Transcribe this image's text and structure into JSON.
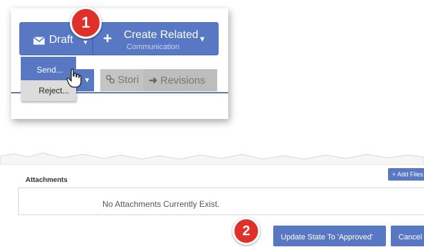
{
  "toolbar": {
    "draft_label": "Draft",
    "create_related_label": "Create Related",
    "create_related_sub": "Communication"
  },
  "dropdown": {
    "send_label": "Send...",
    "reject_label": "Reject..."
  },
  "tabs": {
    "stories_label": "Stori",
    "revisions_label": "Revisions"
  },
  "callouts": {
    "first": "1",
    "second": "2"
  },
  "attachments": {
    "title": "Attachments",
    "add_files_label": "Add Files",
    "empty_message": "No Attachments Currently Exist."
  },
  "actions": {
    "update_state_label": "Update State To 'Approved'",
    "cancel_label": "Cancel"
  },
  "colors": {
    "primary": "#5878c4",
    "callout": "#e0302a",
    "tab_grey": "#c4c4c4"
  }
}
